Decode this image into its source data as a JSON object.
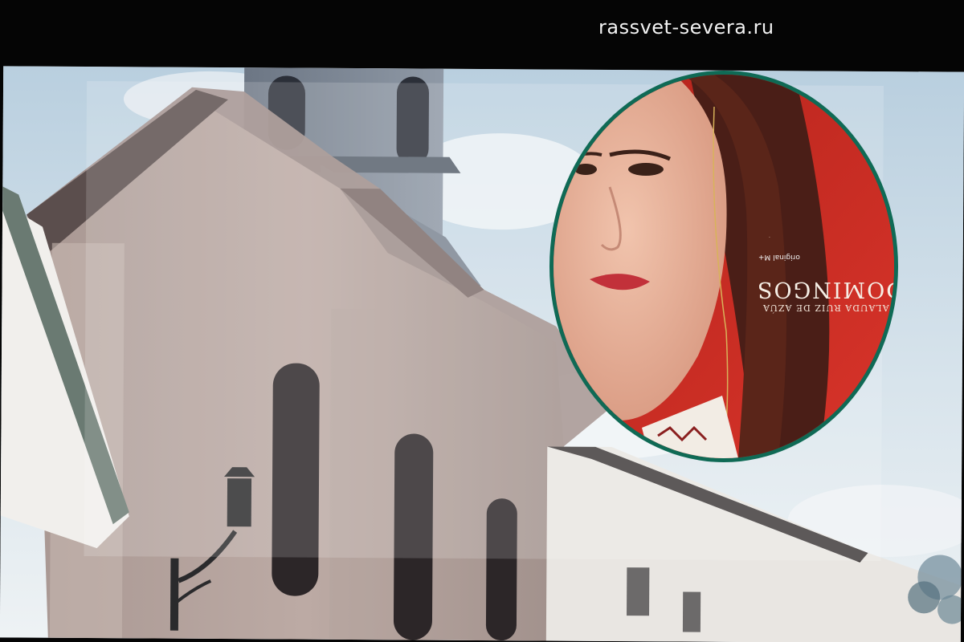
{
  "watermark": {
    "site": "rassvet-severa.ru"
  },
  "scene": {
    "photo_subject": "church-with-bell-tower",
    "inset_subject": "portrait-woman-red-background"
  },
  "poster": {
    "badge": "original M+",
    "title": "DOMINGOS",
    "credit": "A DE ALAUDA RUIZ DE AZÚA"
  },
  "colors": {
    "background": "#050505",
    "inset_border": "#0f6a55",
    "poster_red": "#c2261a",
    "watermark_text": "#f2f2f2"
  }
}
